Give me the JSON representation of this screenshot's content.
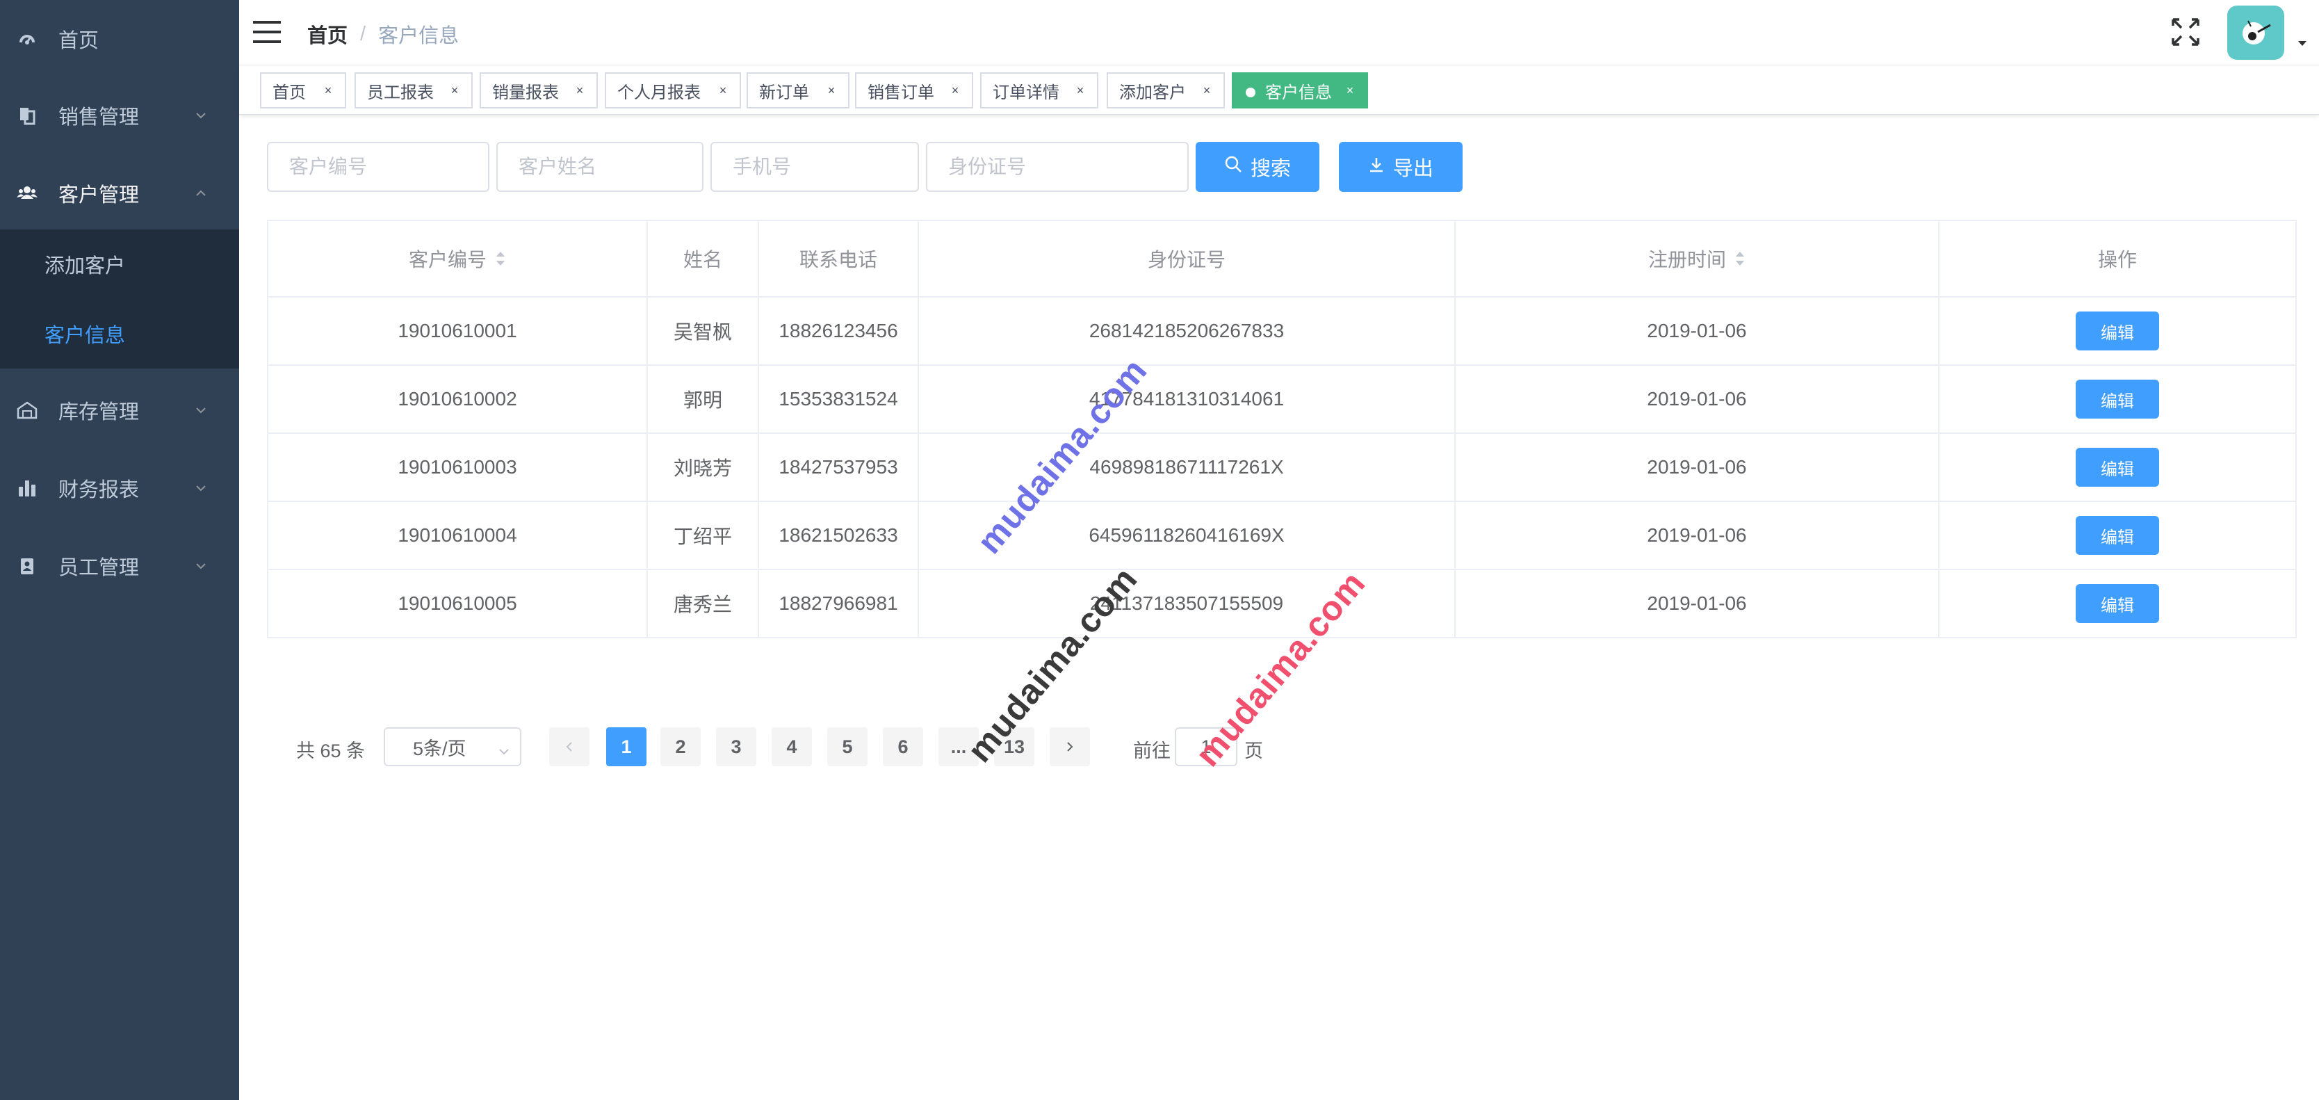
{
  "sidebar": {
    "items": [
      {
        "label": "首页",
        "icon": "dashboard-icon"
      },
      {
        "label": "销售管理",
        "icon": "documents-icon"
      },
      {
        "label": "客户管理",
        "icon": "people-icon",
        "expanded": true,
        "children": [
          {
            "label": "添加客户"
          },
          {
            "label": "客户信息",
            "active": true
          }
        ]
      },
      {
        "label": "库存管理",
        "icon": "warehouse-icon"
      },
      {
        "label": "财务报表",
        "icon": "bar-chart-icon"
      },
      {
        "label": "员工管理",
        "icon": "badge-icon"
      }
    ]
  },
  "navbar": {
    "breadcrumb": {
      "home": "首页",
      "separator": "/",
      "current": "客户信息"
    }
  },
  "tags": [
    {
      "label": "首页"
    },
    {
      "label": "员工报表"
    },
    {
      "label": "销量报表"
    },
    {
      "label": "个人月报表"
    },
    {
      "label": "新订单"
    },
    {
      "label": "销售订单"
    },
    {
      "label": "订单详情"
    },
    {
      "label": "添加客户"
    },
    {
      "label": "客户信息",
      "active": true
    }
  ],
  "filters": {
    "customer_id_placeholder": "客户编号",
    "customer_name_placeholder": "客户姓名",
    "phone_placeholder": "手机号",
    "id_card_placeholder": "身份证号",
    "search_label": "搜索",
    "export_label": "导出"
  },
  "table": {
    "headers": {
      "customer_id": "客户编号",
      "name": "姓名",
      "phone": "联系电话",
      "id_card": "身份证号",
      "register_time": "注册时间",
      "actions": "操作"
    },
    "edit_label": "编辑",
    "rows": [
      {
        "customer_id": "19010610001",
        "name": "吴智枫",
        "phone": "18826123456",
        "id_card": "268142185206267833",
        "register_time": "2019-01-06"
      },
      {
        "customer_id": "19010610002",
        "name": "郭明",
        "phone": "15353831524",
        "id_card": "417784181310314061",
        "register_time": "2019-01-06"
      },
      {
        "customer_id": "19010610003",
        "name": "刘晓芳",
        "phone": "18427537953",
        "id_card": "46989818671117261X",
        "register_time": "2019-01-06"
      },
      {
        "customer_id": "19010610004",
        "name": "丁绍平",
        "phone": "18621502633",
        "id_card": "64596118260416169X",
        "register_time": "2019-01-06"
      },
      {
        "customer_id": "19010610005",
        "name": "唐秀兰",
        "phone": "18827966981",
        "id_card": "241137183507155509",
        "register_time": "2019-01-06"
      }
    ]
  },
  "pagination": {
    "total_text": "共 65 条",
    "page_size": "5条/页",
    "pages": [
      "1",
      "2",
      "3",
      "4",
      "5",
      "6",
      "...",
      "13"
    ],
    "current": "1",
    "goto_label": "前往",
    "goto_value": "1",
    "goto_unit": "页"
  },
  "watermarks": [
    "mudaima.com",
    "mudaima.com",
    "mudaima.com"
  ],
  "colors": {
    "sidebar_bg": "#304156",
    "submenu_bg": "#1f2d3d",
    "primary": "#409eff",
    "active_tag": "#42b983",
    "watermark_blue": "#6f72e6",
    "watermark_dark": "#3a3a3a",
    "watermark_red": "#f0506e"
  }
}
